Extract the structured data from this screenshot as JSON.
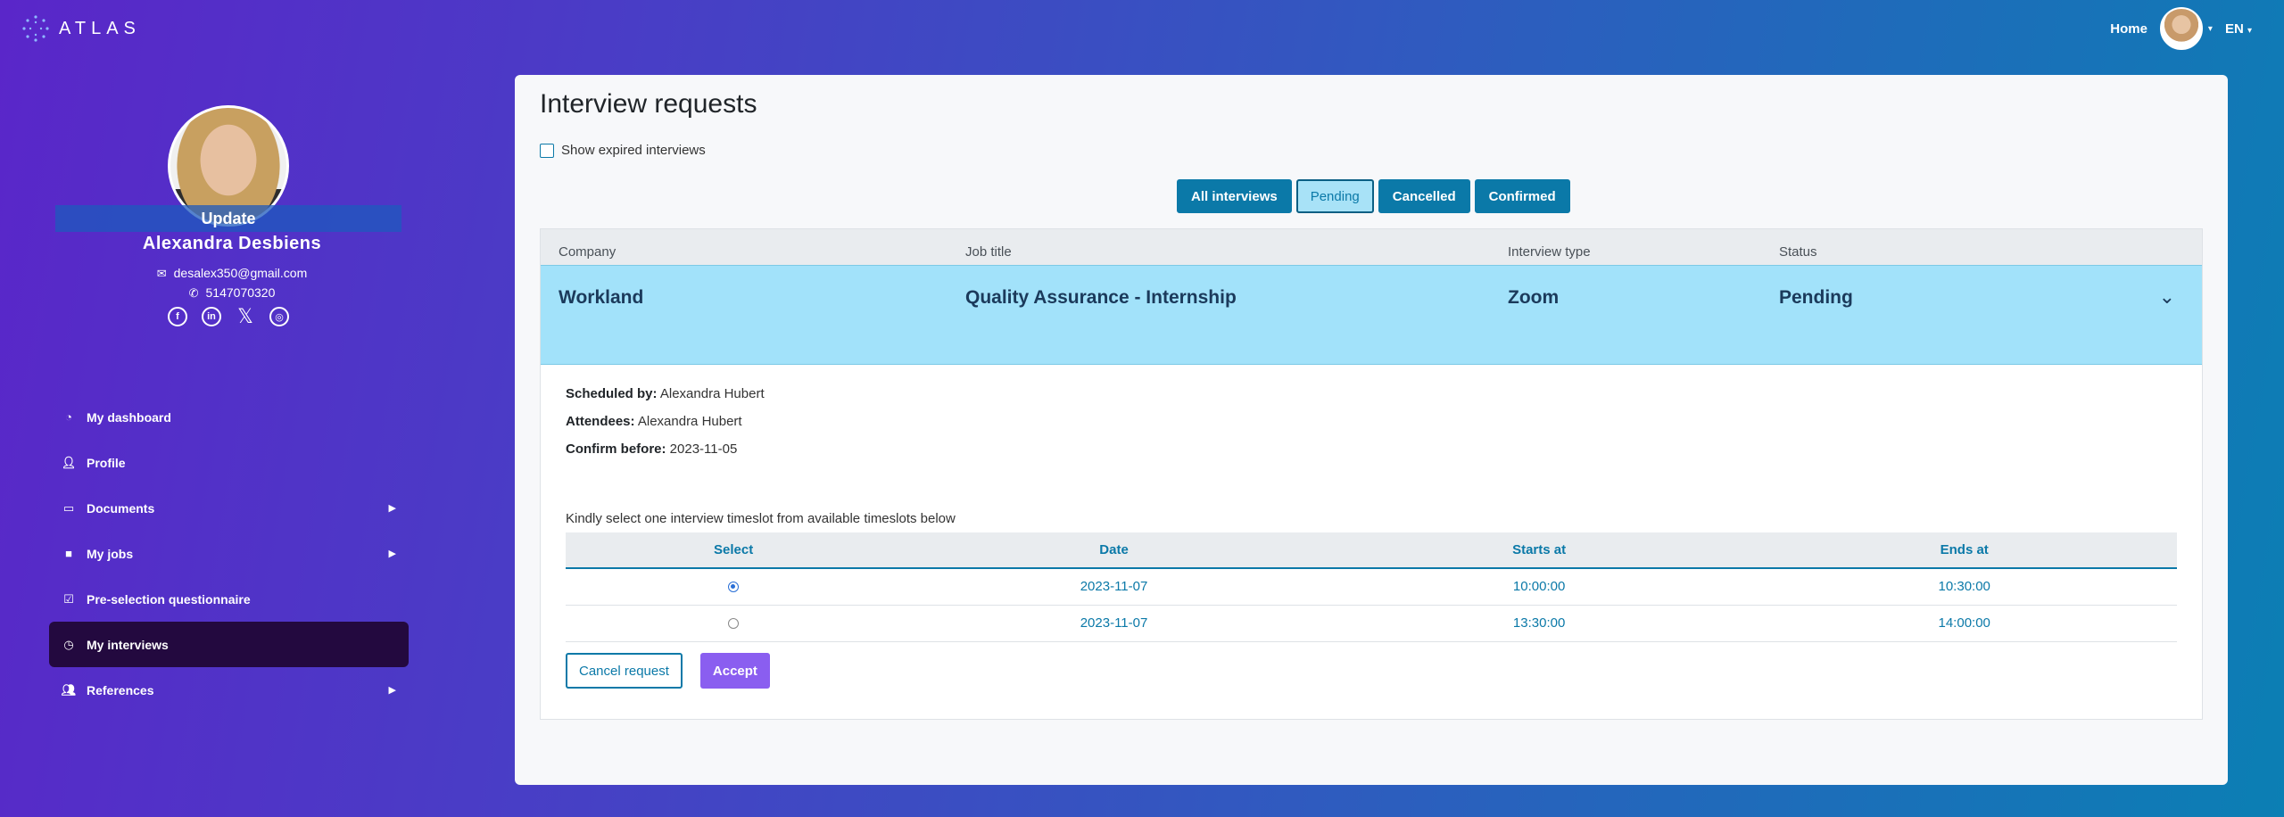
{
  "header": {
    "logo_text": "ATLAS",
    "home_label": "Home",
    "language": "EN"
  },
  "profile": {
    "update_label": "Update",
    "name": "Alexandra  Desbiens",
    "email": "desalex350@gmail.com",
    "phone": "5147070320",
    "social": [
      "facebook-icon",
      "linkedin-icon",
      "x-icon",
      "globe-icon"
    ]
  },
  "sidebar": {
    "items": [
      {
        "label": "My dashboard",
        "icon": "dashboard-icon"
      },
      {
        "label": "Profile",
        "icon": "user-icon"
      },
      {
        "label": "Documents",
        "icon": "folder-icon"
      },
      {
        "label": "My jobs",
        "icon": "briefcase-icon"
      },
      {
        "label": "Pre-selection questionnaire",
        "icon": "checkbox-icon"
      },
      {
        "label": "My interviews",
        "icon": "clock-icon"
      },
      {
        "label": "References",
        "icon": "users-icon"
      }
    ]
  },
  "main": {
    "title": "Interview requests",
    "show_expired_label": "Show expired interviews",
    "filters": [
      "All interviews",
      "Pending",
      "Cancelled",
      "Confirmed"
    ],
    "active_filter": "Pending",
    "columns": [
      "Company",
      "Job title",
      "Interview type",
      "Status"
    ],
    "request": {
      "company": "Workland",
      "job_title": "Quality Assurance - Internship",
      "interview_type": "Zoom",
      "status": "Pending",
      "scheduled_by_label": "Scheduled by:",
      "scheduled_by": "Alexandra Hubert",
      "attendees_label": "Attendees:",
      "attendees": "Alexandra Hubert",
      "confirm_before_label": "Confirm before:",
      "confirm_before": "2023-11-05",
      "instruction": "Kindly select one interview timeslot from available timeslots below",
      "slot_columns": [
        "Select",
        "Date",
        "Starts at",
        "Ends at"
      ],
      "slots": [
        {
          "date": "2023-11-07",
          "start": "10:00:00",
          "end": "10:30:00",
          "selected": true
        },
        {
          "date": "2023-11-07",
          "start": "13:30:00",
          "end": "14:00:00",
          "selected": false
        }
      ],
      "cancel_label": "Cancel request",
      "accept_label": "Accept"
    }
  },
  "colors": {
    "accent": "#0b79a8",
    "row_highlight": "#a2e2fa",
    "accept": "#8a5ef0",
    "active_nav": "#23093f"
  }
}
